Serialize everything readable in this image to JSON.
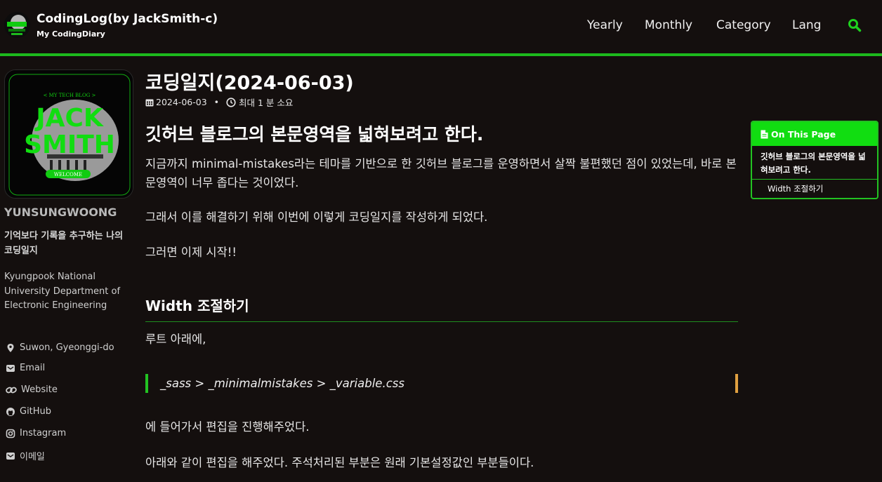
{
  "header": {
    "site_title": "CodingLog(by JackSmith-c)",
    "site_subtitle": "My CodingDiary",
    "nav": [
      "Yearly",
      "Monthly",
      "Category",
      "Lang"
    ]
  },
  "sidebar": {
    "author_name": "YUNSUNGWOONG",
    "bio": "기억보다 기록을 추구하는 나의 코딩일지",
    "org": "Kyungpook National University Department of Electronic Engineering",
    "links": [
      {
        "icon": "location-icon",
        "label": "Suwon, Gyeonggi-do"
      },
      {
        "icon": "envelope-icon",
        "label": "Email"
      },
      {
        "icon": "link-icon",
        "label": "Website"
      },
      {
        "icon": "github-icon",
        "label": "GitHub"
      },
      {
        "icon": "instagram-icon",
        "label": "Instagram"
      },
      {
        "icon": "envelope-icon",
        "label": "이메일"
      }
    ]
  },
  "post": {
    "title": "코딩일지(2024-06-03)",
    "date": "2024-06-03",
    "read_time": "최대 1 분 소요",
    "h1": "깃허브 블로그의 본문영역을 넓혀보려고 한다.",
    "para1": "지금까지 minimal-mistakes라는 테마를 기반으로 한 깃허브 블로그를 운영하면서 살짝 불편했던 점이 있었는데, 바로 본문영역이 너무 좁다는 것이었다.",
    "para2": "그래서 이를 해결하기 위해 이번에 이렇게 코딩일지를 작성하게 되었다.",
    "para3": "그러면 이제 시작!!",
    "h2": "Width 조절하기",
    "para4": "루트 아래에,",
    "quote": "_sass > _minimalmistakes > _variable.css",
    "para5": "에 들어가서 편집을 진행해주었다.",
    "para6": "아래와 같이 편집을 해주었다. 주석처리된 부분은 원래 기본설정값인 부분들이다."
  },
  "toc": {
    "header": "On This Page",
    "item1": "깃허브 블로그의 본문영역을 넓혀보려고 한다.",
    "item2": "Width 조절하기"
  },
  "avatar": {
    "line1": "JACK",
    "line2": "SMITH",
    "banner": "< MY TECH BLOG >",
    "button": "WELCOME"
  },
  "colors": {
    "accent": "#1db91d",
    "background": "#140f0e",
    "quote_right": "#e0a040"
  }
}
